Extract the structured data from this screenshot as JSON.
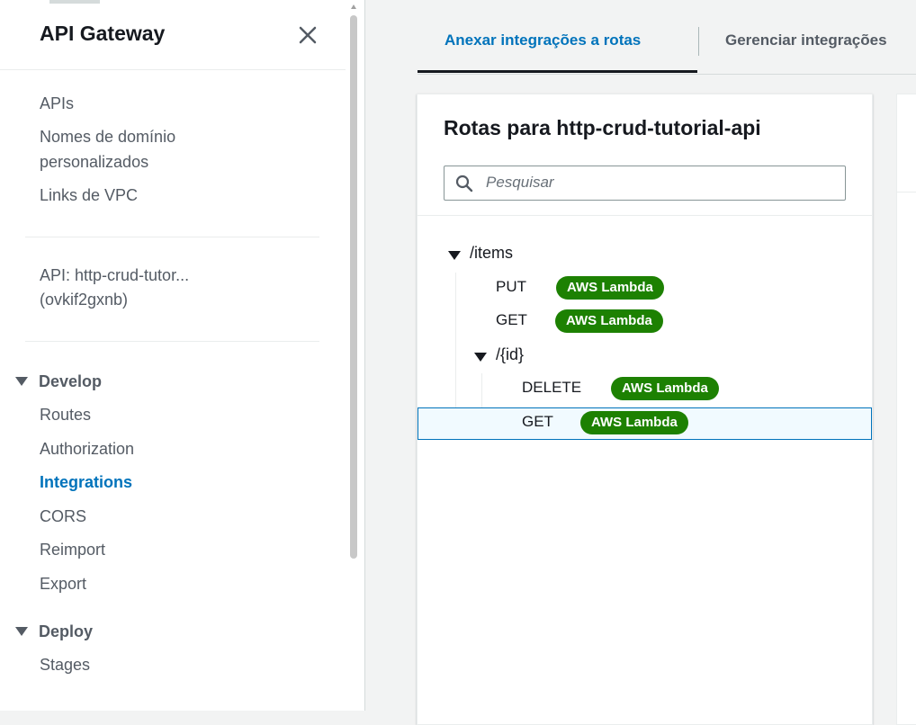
{
  "sidebar": {
    "title": "API Gateway",
    "links": {
      "apis": "APIs",
      "custom_domains": "Nomes de domínio personalizados",
      "vpc_links": "Links de VPC"
    },
    "api_name": "API: http-crud-tutor...",
    "api_id": "(ovkif2gxnb)",
    "sections": {
      "develop": {
        "label": "Develop",
        "items": [
          "Routes",
          "Authorization",
          "Integrations",
          "CORS",
          "Reimport",
          "Export"
        ],
        "active": "Integrations"
      },
      "deploy": {
        "label": "Deploy",
        "items": [
          "Stages"
        ]
      }
    }
  },
  "tabs": [
    {
      "label": "Anexar integrações a rotas",
      "active": true
    },
    {
      "label": "Gerenciar integrações",
      "active": false
    }
  ],
  "routes_panel": {
    "title": "Rotas para http-crud-tutorial-api",
    "search": {
      "placeholder": "Pesquisar",
      "value": ""
    },
    "tree": {
      "resource": "/items",
      "methods": [
        {
          "method": "PUT",
          "integration": "AWS Lambda"
        },
        {
          "method": "GET",
          "integration": "AWS Lambda"
        }
      ],
      "child": {
        "resource": "/{id}",
        "methods": [
          {
            "method": "DELETE",
            "integration": "AWS Lambda"
          },
          {
            "method": "GET",
            "integration": "AWS Lambda",
            "selected": true
          }
        ]
      }
    }
  },
  "colors": {
    "accent": "#0073bb",
    "badge": "#1d8102",
    "selected_row_bg": "#f1faff",
    "page_bg": "#f2f3f3"
  },
  "icons": [
    "close-icon",
    "caret-down-icon",
    "search-icon"
  ]
}
